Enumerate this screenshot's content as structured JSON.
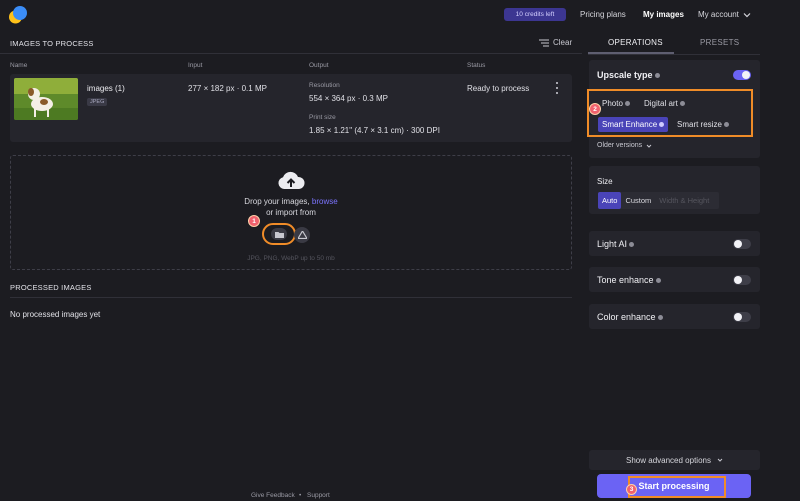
{
  "header": {
    "credits": "10 credits left",
    "nav": {
      "pricing": "Pricing plans",
      "my_images": "My images",
      "account": "My account"
    }
  },
  "left": {
    "section_title": "IMAGES TO PROCESS",
    "clear_label": "Clear",
    "columns": [
      "Name",
      "Input",
      "Output",
      "Status"
    ],
    "image_row": {
      "name": "images (1)",
      "format": "JPEG",
      "input": "277 × 182 px · 0.1 MP",
      "resolution_label": "Resolution",
      "resolution": "554 × 364 px · 0.3 MP",
      "print_label": "Print size",
      "print_size": "1.85 × 1.21\" (4.7 × 3.1 cm) · 300 DPI",
      "status": "Ready to process"
    },
    "dropzone": {
      "line1_prefix": "Drop your images,",
      "line1_link": "browse",
      "line2": "or import from",
      "hint": "JPG, PNG, WebP up to 50 mb"
    },
    "processed_title": "PROCESSED IMAGES",
    "processed_empty": "No processed images yet"
  },
  "right": {
    "tabs": [
      "OPERATIONS",
      "PRESETS"
    ],
    "upscale": {
      "title": "Upscale type",
      "options": [
        "Photo",
        "Digital art",
        "Smart Enhance",
        "Smart resize"
      ],
      "selected": "Smart Enhance",
      "older_versions": "Older versions",
      "enabled": true
    },
    "size": {
      "title": "Size",
      "options": [
        "Auto",
        "Custom",
        "Width & Height"
      ],
      "selected": "Auto"
    },
    "toggles": [
      {
        "label": "Light AI",
        "on": false
      },
      {
        "label": "Tone enhance",
        "on": false
      },
      {
        "label": "Color enhance",
        "on": false
      }
    ],
    "advanced": "Show advanced options",
    "start": "Start processing"
  },
  "steps": [
    "1",
    "2",
    "3"
  ],
  "footer": {
    "feedback": "Give Feedback",
    "separator": "•",
    "support": "Support"
  },
  "colors": {
    "accent": "#6b63f4",
    "highlight": "#f08c28",
    "step_badge": "#f0626e",
    "background": "#1c1c21"
  }
}
